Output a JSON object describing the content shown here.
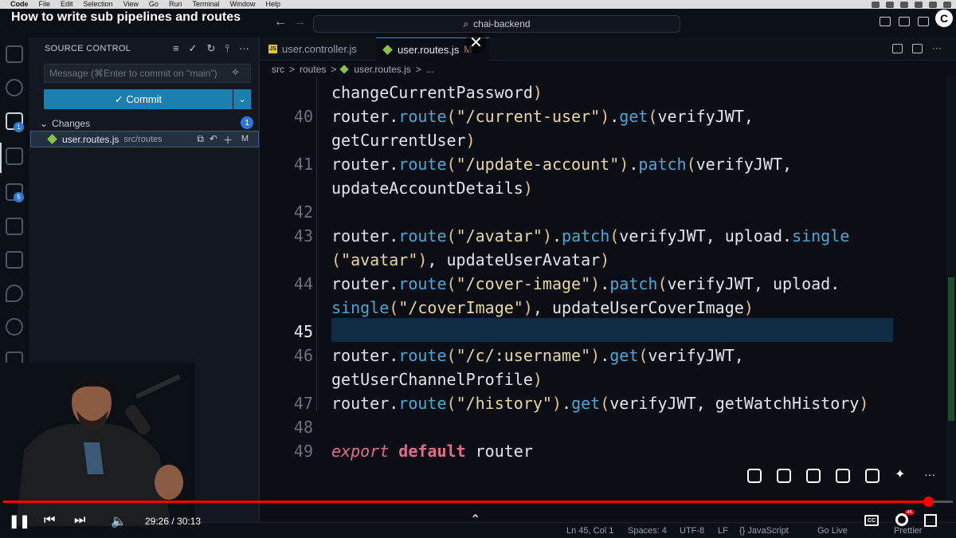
{
  "menubar": {
    "apple": "",
    "items": [
      "Code",
      "File",
      "Edit",
      "Selection",
      "View",
      "Go",
      "Run",
      "Terminal",
      "Window",
      "Help"
    ]
  },
  "video": {
    "title": "How to write sub pipelines and routes",
    "time": "29:26 / 30:13",
    "progress_fraction": 0.974
  },
  "titlebar": {
    "search_text": "chai-backend"
  },
  "activity": {
    "scm_badge": "1",
    "extensions_badge": "5"
  },
  "sidebar": {
    "title": "SOURCE CONTROL",
    "message_placeholder": "Message (⌘Enter to commit on \"main\")",
    "commit_label": "✓ Commit",
    "changes_label": "Changes",
    "changes_count": "1",
    "file_name": "user.routes.js",
    "file_path": "src/routes",
    "file_status": "M"
  },
  "tabs": [
    {
      "label": "user.controller.js"
    },
    {
      "label": "user.routes.js",
      "modified": "M"
    }
  ],
  "breadcrumbs": [
    "src",
    ">",
    "routes",
    ">",
    "user.routes.js",
    ">",
    "..."
  ],
  "code": {
    "lines": [
      {
        "n": "",
        "text": "changeCurrentPassword)"
      },
      {
        "n": "40",
        "text": "router.route(\"/current-user\").get(verifyJWT,"
      },
      {
        "n": "",
        "text": "getCurrentUser)"
      },
      {
        "n": "41",
        "text": "router.route(\"/update-account\").patch(verifyJWT,"
      },
      {
        "n": "",
        "text": "updateAccountDetails)"
      },
      {
        "n": "42",
        "text": ""
      },
      {
        "n": "43",
        "text": "router.route(\"/avatar\").patch(verifyJWT, upload.single"
      },
      {
        "n": "",
        "text": "(\"avatar\"), updateUserAvatar)"
      },
      {
        "n": "44",
        "text": "router.route(\"/cover-image\").patch(verifyJWT, upload."
      },
      {
        "n": "",
        "text": "single(\"/coverImage\"), updateUserCoverImage)"
      },
      {
        "n": "45",
        "text": ""
      },
      {
        "n": "46",
        "text": "router.route(\"/c/:username\").get(verifyJWT,"
      },
      {
        "n": "",
        "text": "getUserChannelProfile)"
      },
      {
        "n": "47",
        "text": "router.route(\"/history\").get(verifyJWT, getWatchHistory)"
      },
      {
        "n": "48",
        "text": ""
      },
      {
        "n": "49",
        "text": "export default router"
      }
    ],
    "current_line": "45"
  },
  "statusbar": {
    "position": "Ln 45, Col 1",
    "spaces": "Spaces: 4",
    "encoding": "UTF-8",
    "eol": "LF",
    "language": "{} JavaScript",
    "golive": "Go Live",
    "prettier": "Prettier"
  },
  "colors": {
    "accent": "#1b7fb0",
    "progress": "#ff0000",
    "line_highlight": "#102b44"
  }
}
